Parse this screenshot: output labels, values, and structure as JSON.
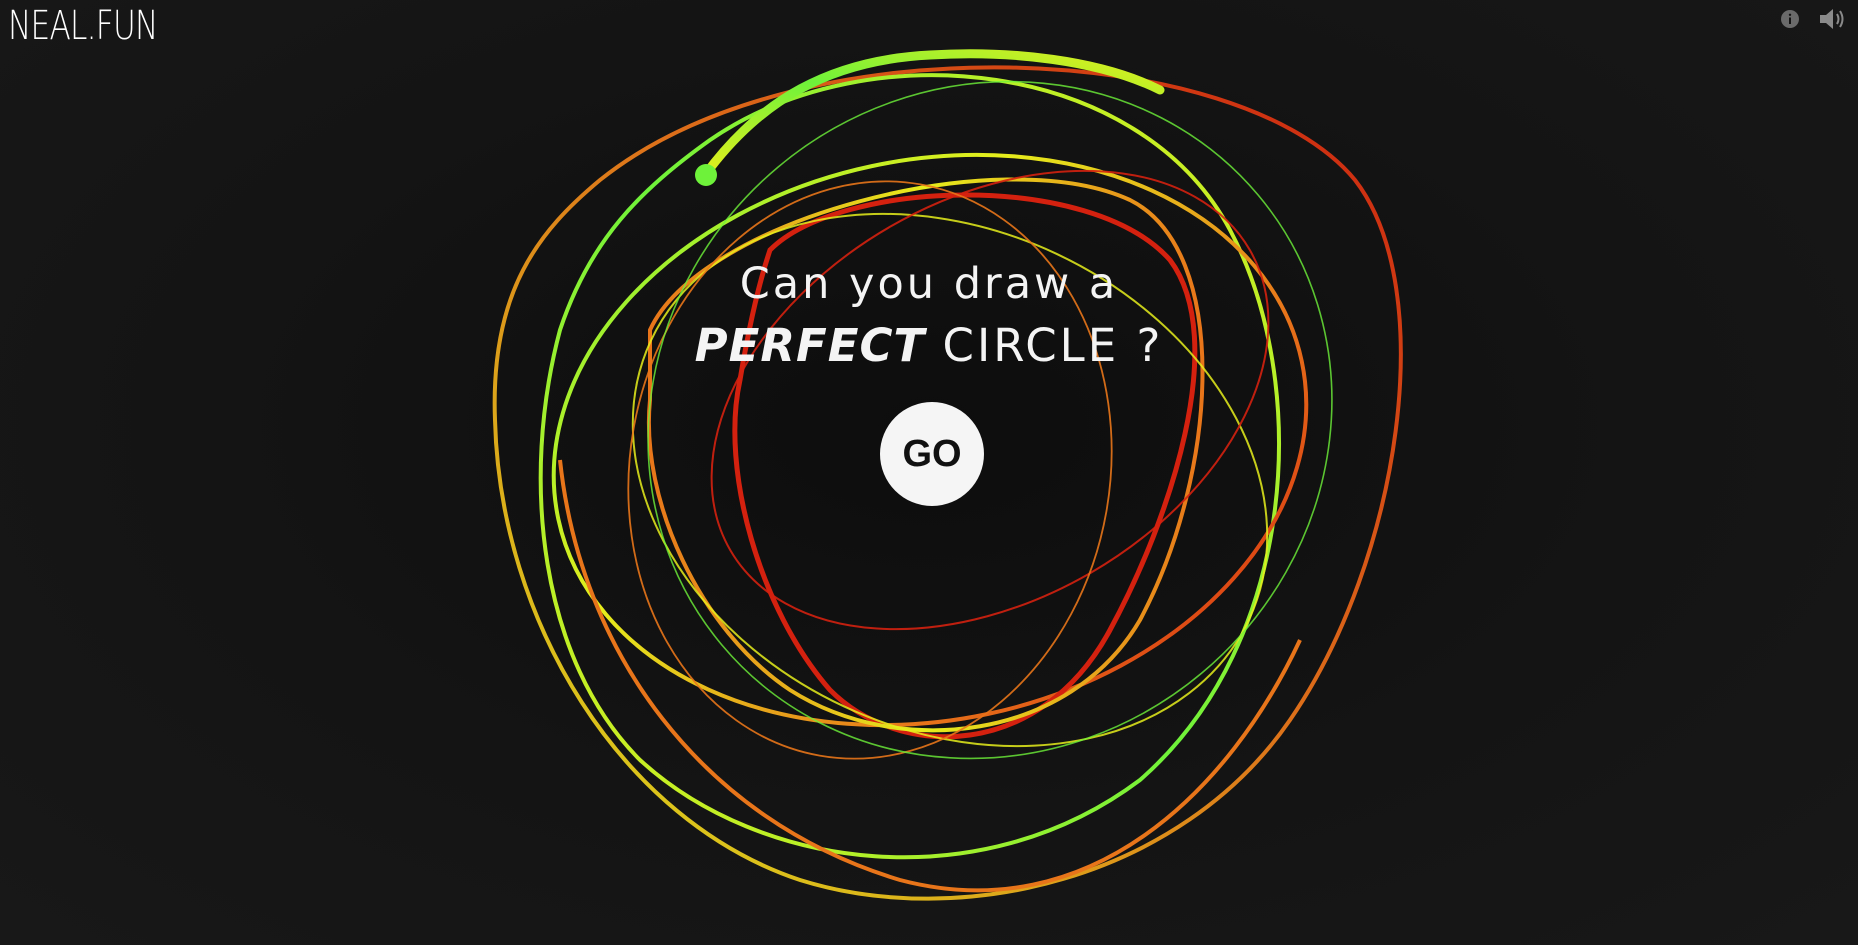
{
  "site": {
    "logo_text": "NEAL.FUN"
  },
  "toolbar": {
    "icons": [
      "info-icon",
      "speaker-icon"
    ]
  },
  "hero": {
    "line1": "Can you draw a",
    "emphasis": "PERFECT",
    "rest": " CIRCLE ?",
    "go_label": "GO"
  },
  "colors": {
    "background": "#141414",
    "text": "#f4f4f4",
    "button_bg": "#f5f5f5",
    "stroke_red": "#d4210f",
    "stroke_orange": "#e8751a",
    "stroke_yellow": "#e6ee1c",
    "stroke_green": "#6ef23a"
  }
}
